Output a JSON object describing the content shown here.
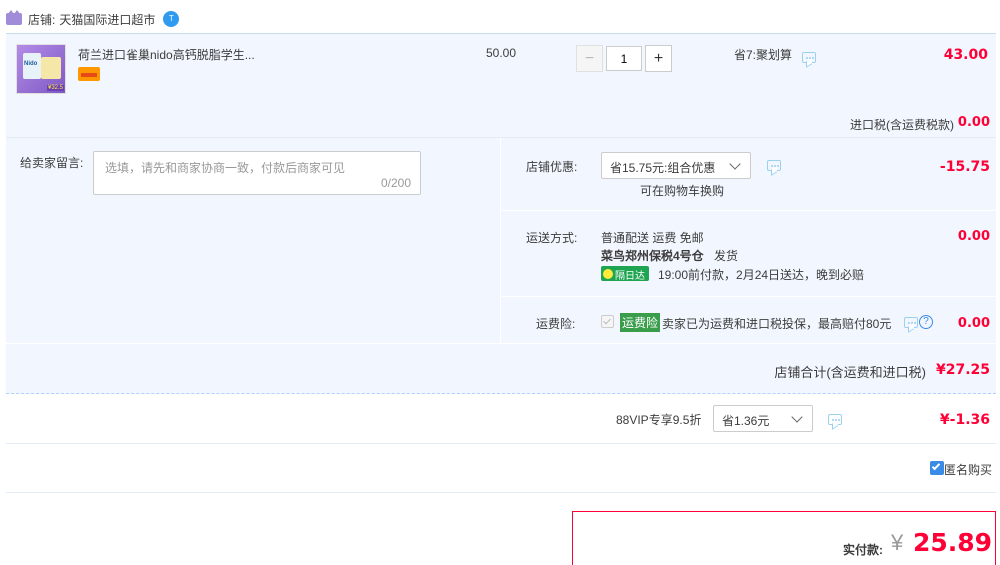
{
  "shop": {
    "label": "店铺:",
    "name": "天猫国际进口超市",
    "badge": "T"
  },
  "item": {
    "title": "荷兰进口雀巢nido高钙脱脂学生...",
    "price": "50.00",
    "quantity": "1",
    "minus": "−",
    "plus": "+",
    "promo": "省7:聚划算",
    "subtotal": "43.00",
    "thumb_text": "Nido",
    "thumb_price": "¥32.5"
  },
  "tax": {
    "label": "进口税(含运费税款)",
    "value": "0.00"
  },
  "message": {
    "label": "给卖家留言:",
    "placeholder": "选填，请先和商家协商一致，付款后商家可见",
    "counter": "0/200"
  },
  "shop_discount": {
    "label": "店铺优惠:",
    "selected": "省15.75元:组合优惠",
    "sub": "可在购物车换购",
    "value": "-15.75"
  },
  "shipping": {
    "label": "运送方式:",
    "line1": "普通配送 运费 免邮",
    "warehouse": "菜鸟郑州保税4号仓",
    "ship_text": "发货",
    "badge": "隔日达",
    "eta": "19:00前付款，2月24日送达，晚到必赔",
    "value": "0.00"
  },
  "insurance": {
    "label": "运费险:",
    "tag": "运费险",
    "text": "卖家已为运费和进口税投保，最高赔付80元",
    "help": "?",
    "value": "0.00"
  },
  "shop_total": {
    "label": "店铺合计(含运费和进口税)",
    "value": "¥27.25"
  },
  "vip": {
    "label": "88VIP专享9.5折",
    "selected": "省1.36元",
    "value": "¥-1.36"
  },
  "anonymous": {
    "label": "匿名购买",
    "checked": true
  },
  "pay": {
    "label": "实付款:",
    "currency": "¥",
    "value": "25.89"
  },
  "colors": {
    "accent_red": "#ff0036",
    "band_blue": "#f2f7ff",
    "border_blue": "#b2d1ff"
  }
}
